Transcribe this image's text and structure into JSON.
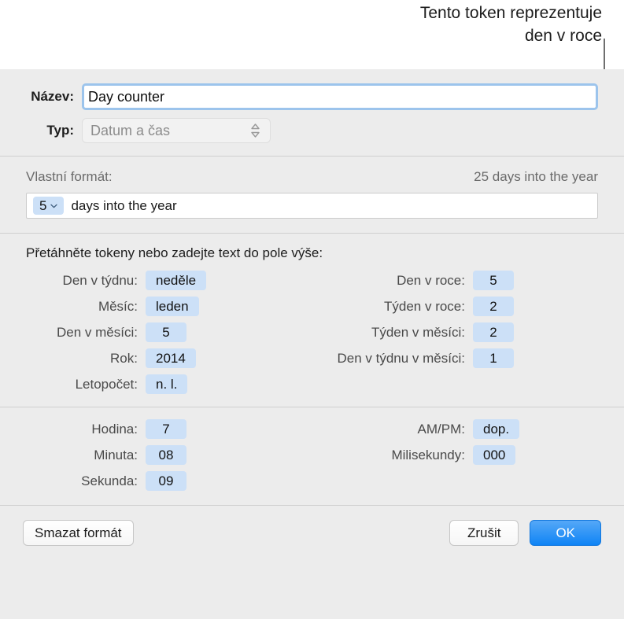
{
  "annotation": {
    "text": "Tento token reprezentuje\nden v roce",
    "line_color": "#6f6f6f"
  },
  "dialog": {
    "name_field": {
      "label": "Název:",
      "value": "Day counter",
      "placeholder": "Název"
    },
    "type_field": {
      "label": "Typ:",
      "value": "Datum a čas",
      "stepper_icon": "chevron-up-down-icon",
      "disabled": true
    },
    "format_section": {
      "label": "Vlastní formát:",
      "preview": "25 days into the year",
      "token": {
        "value": "5",
        "chevron_icon": "chevron-down-icon"
      },
      "text": "days into the year"
    },
    "tokens_section": {
      "hint": "Přetáhněte tokeny nebo zadejte text do pole výše:",
      "left_column": [
        {
          "label": "Den v týdnu:",
          "value": "neděle"
        },
        {
          "label": "Měsíc:",
          "value": "leden"
        },
        {
          "label": "Den v měsíci:",
          "value": "5"
        },
        {
          "label": "Rok:",
          "value": "2014"
        },
        {
          "label": "Letopočet:",
          "value": "n. l."
        }
      ],
      "right_column": [
        {
          "label": "Den v roce:",
          "value": "5"
        },
        {
          "label": "Týden v roce:",
          "value": "2"
        },
        {
          "label": "Týden v měsíci:",
          "value": "2"
        },
        {
          "label": "Den v týdnu v měsíci:",
          "value": "1"
        }
      ]
    },
    "time_section": {
      "left_column": [
        {
          "label": "Hodina:",
          "value": "7"
        },
        {
          "label": "Minuta:",
          "value": "08"
        },
        {
          "label": "Sekunda:",
          "value": "09"
        }
      ],
      "right_column": [
        {
          "label": "AM/PM:",
          "value": "dop."
        },
        {
          "label": "Milisekundy:",
          "value": "000"
        }
      ]
    },
    "footer": {
      "delete_format_label": "Smazat formát",
      "cancel_label": "Zrušit",
      "ok_label": "OK"
    }
  },
  "colors": {
    "token_chip": "#cce0f7",
    "accent_blue": "#0f84f5",
    "focus_ring": "#9cc4ec",
    "dialog_bg": "#ececec",
    "separator": "#cfcfcf"
  }
}
